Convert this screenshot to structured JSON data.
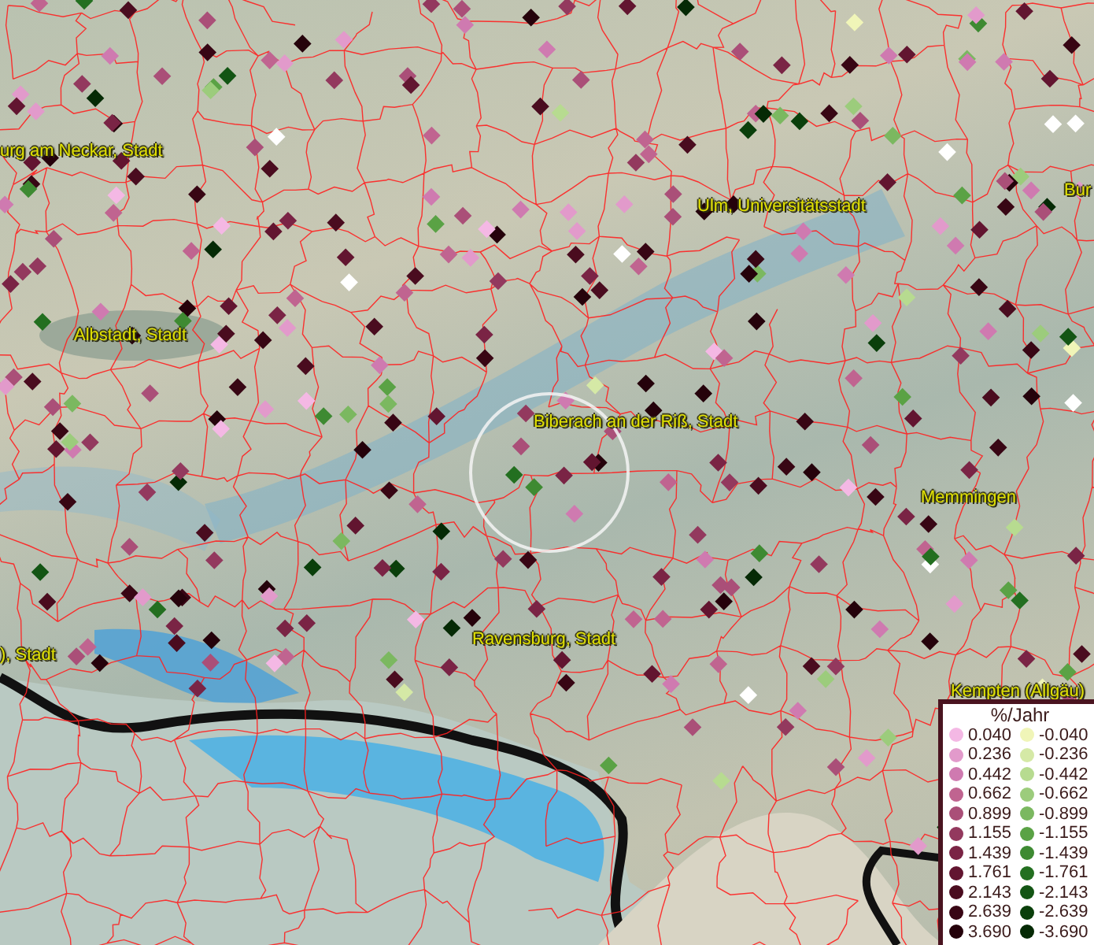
{
  "map": {
    "places": [
      {
        "name": "urg am Neckar, Stadt"
      },
      {
        "name": "Ulm, Universitätsstadt"
      },
      {
        "name": "Bur"
      },
      {
        "name": "Albstadt, Stadt"
      },
      {
        "name": "Biberach an der Riß, Stadt"
      },
      {
        "name": "Memmingen"
      },
      {
        "name": "Ravensburg, Stadt"
      },
      {
        "name": "), Stadt"
      },
      {
        "name": "Kempten (Allgäu)"
      }
    ]
  },
  "legend": {
    "title": "%/Jahr",
    "rows": [
      {
        "positive": {
          "label": "0.040",
          "color": "#f4b8e4"
        },
        "negative": {
          "label": "-0.040",
          "color": "#f0f5b8"
        }
      },
      {
        "positive": {
          "label": "0.236",
          "color": "#e29acb"
        },
        "negative": {
          "label": "-0.236",
          "color": "#d5e9a6"
        }
      },
      {
        "positive": {
          "label": "0.442",
          "color": "#cf7ab0"
        },
        "negative": {
          "label": "-0.442",
          "color": "#b7db90"
        }
      },
      {
        "positive": {
          "label": "0.662",
          "color": "#c06490"
        },
        "negative": {
          "label": "-0.662",
          "color": "#9ccc7c"
        }
      },
      {
        "positive": {
          "label": "0.899",
          "color": "#aa4f78"
        },
        "negative": {
          "label": "-0.899",
          "color": "#7bb860"
        }
      },
      {
        "positive": {
          "label": "1.155",
          "color": "#93395e"
        },
        "negative": {
          "label": "-1.155",
          "color": "#5aa245"
        }
      },
      {
        "positive": {
          "label": "1.439",
          "color": "#7a2445"
        },
        "negative": {
          "label": "-1.439",
          "color": "#3e8a32"
        }
      },
      {
        "positive": {
          "label": "1.761",
          "color": "#621530"
        },
        "negative": {
          "label": "-1.761",
          "color": "#236f20"
        }
      },
      {
        "positive": {
          "label": "2.143",
          "color": "#4a0c1f"
        },
        "negative": {
          "label": "-2.143",
          "color": "#135514"
        }
      },
      {
        "positive": {
          "label": "2.639",
          "color": "#380614"
        },
        "negative": {
          "label": "-2.639",
          "color": "#0a3f0b"
        }
      },
      {
        "positive": {
          "label": "3.690",
          "color": "#25020b"
        },
        "negative": {
          "label": "-3.690",
          "color": "#052a05"
        }
      }
    ]
  }
}
